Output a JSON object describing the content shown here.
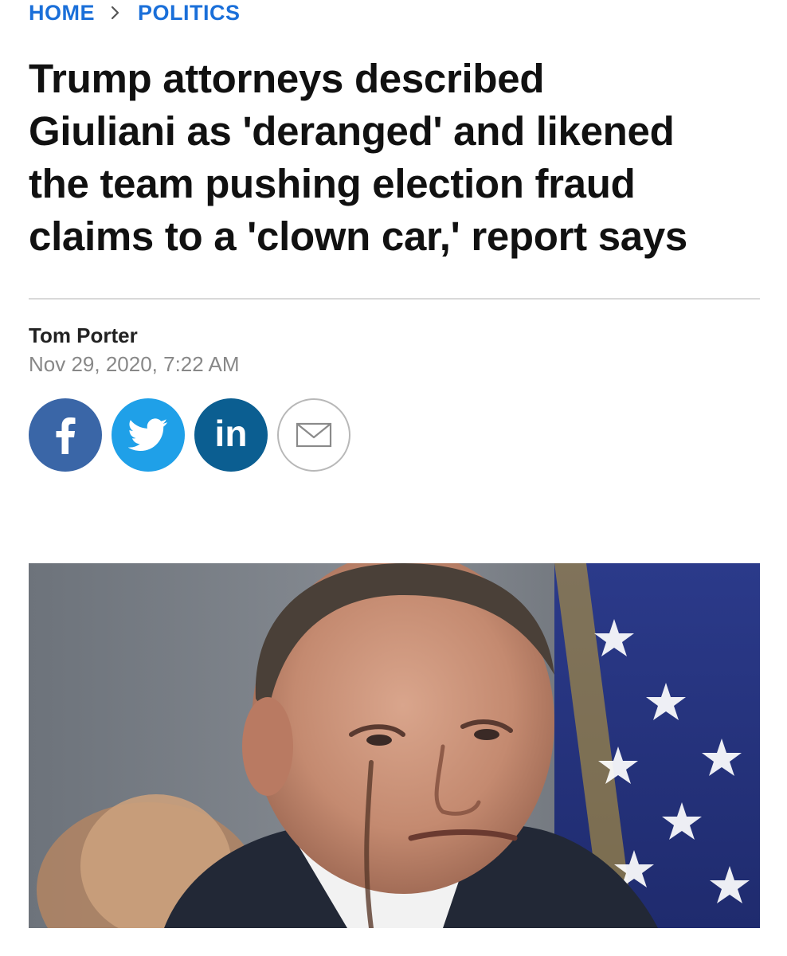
{
  "breadcrumb": {
    "items": [
      "HOME",
      "POLITICS"
    ]
  },
  "article": {
    "headline_lines": [
      "Trump attorneys described",
      "Giuliani as 'deranged' and likened",
      "the team pushing election fraud",
      "claims to a 'clown car,' report says"
    ],
    "author": "Tom Porter",
    "timestamp": "Nov 29, 2020, 7:22 AM"
  },
  "share": {
    "facebook_icon": "facebook-icon",
    "twitter_icon": "twitter-icon",
    "linkedin_label": "in",
    "email_icon": "envelope-icon"
  },
  "colors": {
    "link_blue": "#1a6fd9",
    "facebook": "#3a66a7",
    "twitter": "#1fa0e8",
    "linkedin": "#0b5e91",
    "divider": "#d9d9d9"
  },
  "hero_image": {
    "icon": "news-photo"
  }
}
